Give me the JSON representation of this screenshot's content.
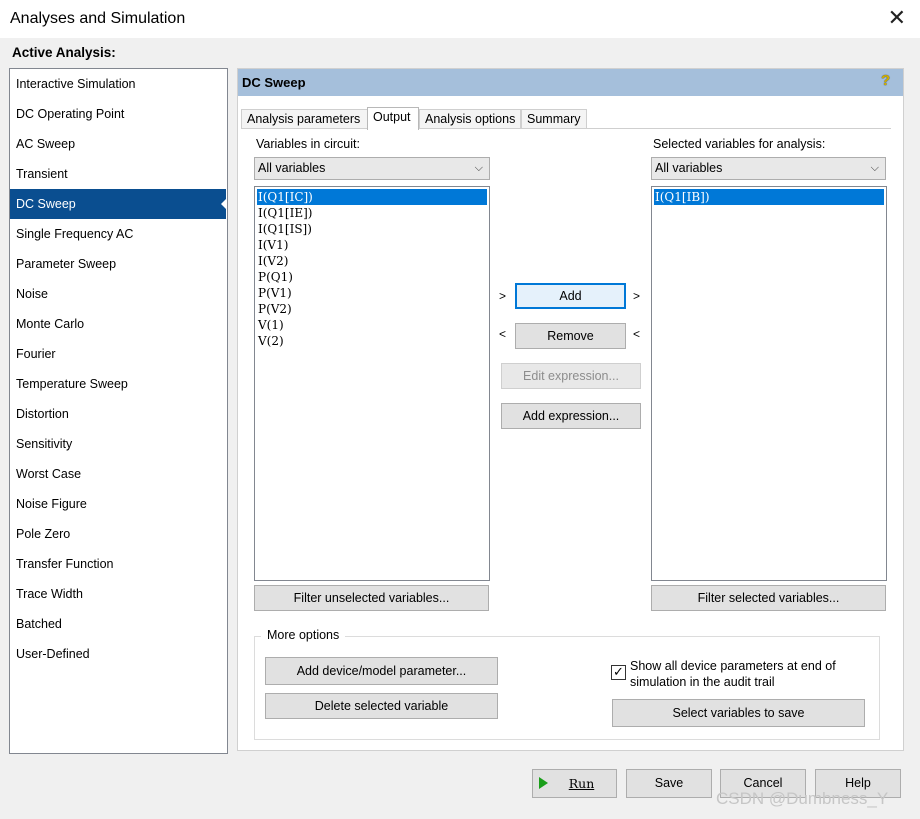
{
  "window": {
    "title": "Analyses and Simulation",
    "close_glyph": "✕"
  },
  "active_analysis_label": "Active Analysis:",
  "sidebar": {
    "items": [
      {
        "label": "Interactive Simulation"
      },
      {
        "label": "DC Operating Point"
      },
      {
        "label": "AC Sweep"
      },
      {
        "label": "Transient"
      },
      {
        "label": "DC Sweep",
        "selected": true
      },
      {
        "label": "Single Frequency AC"
      },
      {
        "label": "Parameter Sweep"
      },
      {
        "label": "Noise"
      },
      {
        "label": "Monte Carlo"
      },
      {
        "label": "Fourier"
      },
      {
        "label": "Temperature Sweep"
      },
      {
        "label": "Distortion"
      },
      {
        "label": "Sensitivity"
      },
      {
        "label": "Worst Case"
      },
      {
        "label": "Noise Figure"
      },
      {
        "label": "Pole Zero"
      },
      {
        "label": "Transfer Function"
      },
      {
        "label": "Trace Width"
      },
      {
        "label": "Batched"
      },
      {
        "label": "User-Defined"
      }
    ]
  },
  "panel": {
    "title": "DC Sweep",
    "help_glyph": "?",
    "tabs": [
      {
        "label": "Analysis parameters"
      },
      {
        "label": "Output",
        "active": true
      },
      {
        "label": "Analysis options"
      },
      {
        "label": "Summary"
      }
    ]
  },
  "output": {
    "left": {
      "label": "Variables in circuit:",
      "filter": "All variables",
      "items": [
        "I(Q1[IC])",
        "I(Q1[IE])",
        "I(Q1[IS])",
        "I(V1)",
        "I(V2)",
        "P(Q1)",
        "P(V1)",
        "P(V2)",
        "V(1)",
        "V(2)"
      ],
      "selected_index": 0,
      "filter_button": "Filter unselected variables..."
    },
    "right": {
      "label": "Selected variables for analysis:",
      "filter": "All variables",
      "items": [
        "I(Q1[IB])"
      ],
      "selected_index": 0,
      "filter_button": "Filter selected variables..."
    },
    "buttons": {
      "add": "Add",
      "remove": "Remove",
      "edit_expression": "Edit expression...",
      "add_expression": "Add expression...",
      "arrow_right": ">",
      "arrow_left": "<"
    },
    "more_options": {
      "title": "More options",
      "add_param": "Add device/model parameter...",
      "delete_var": "Delete selected variable",
      "show_all_checked": true,
      "show_all_line1": "Show all device parameters at end of",
      "show_all_line2": "simulation in the audit trail",
      "select_vars": "Select variables to save"
    }
  },
  "footer": {
    "run": "Run",
    "save": "Save",
    "cancel": "Cancel",
    "help": "Help"
  },
  "watermark": "CSDN @Dumbness_Y"
}
